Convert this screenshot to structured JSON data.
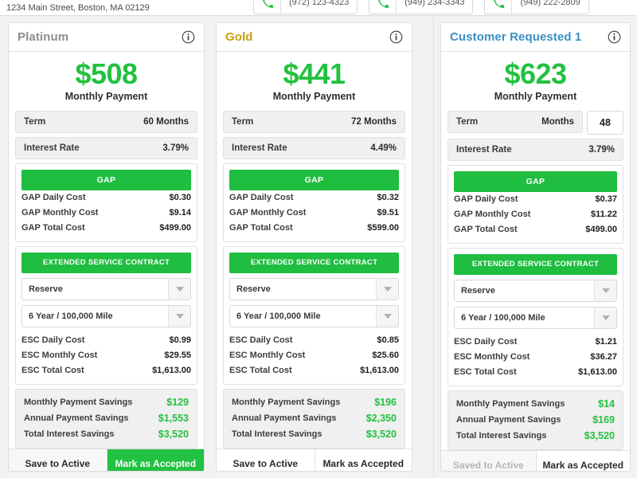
{
  "topbar": {
    "address": "1234 Main Street, Boston, MA 02129",
    "phones": [
      {
        "number": "(972) 123-4323",
        "icon": "phone-icon"
      },
      {
        "number": "(949) 234-3343",
        "icon": "phone-icon"
      },
      {
        "number": "(949) 222-2809",
        "icon": "phone-icon"
      }
    ]
  },
  "colors": {
    "green": "#21c141",
    "gold": "#c7a008",
    "platinum_gray": "#8e8e8e",
    "custom_blue": "#3a8fc0",
    "savings_green": "#22c13f"
  },
  "common": {
    "monthly_payment_label": "Monthly Payment",
    "term_label": "Term",
    "interest_rate_label": "Interest Rate",
    "gap_header": "GAP",
    "gap_daily_label": "GAP Daily Cost",
    "gap_monthly_label": "GAP Monthly Cost",
    "gap_total_label": "GAP Total Cost",
    "esc_header": "EXTENDED SERVICE CONTRACT",
    "esc_daily_label": "ESC Daily Cost",
    "esc_monthly_label": "ESC Monthly Cost",
    "esc_total_label": "ESC Total Cost",
    "monthly_savings_label": "Monthly Payment Savings",
    "annual_savings_label": "Annual Payment Savings",
    "total_interest_savings_label": "Total Interest Savings",
    "info_icon": "info-icon",
    "dropdown_icon": "chevron-down-icon"
  },
  "cards": [
    {
      "title": "Platinum",
      "payment": "$508",
      "term_value": "60 Months",
      "term_editable": false,
      "interest_rate": "3.79%",
      "gap": {
        "daily": "$0.30",
        "monthly": "$9.14",
        "total": "$499.00"
      },
      "esc": {
        "provider": "Reserve",
        "coverage": "6 Year / 100,000 Mile",
        "daily": "$0.99",
        "monthly": "$29.55",
        "total": "$1,613.00"
      },
      "savings": {
        "monthly": "$129",
        "annual": "$1,553",
        "interest": "$3,520"
      },
      "footer": {
        "save_label": "Save to Active",
        "save_state": "enabled",
        "accept_label": "Mark as Accepted",
        "accept_state": "accepted"
      }
    },
    {
      "title": "Gold",
      "payment": "$441",
      "term_value": "72 Months",
      "term_editable": false,
      "interest_rate": "4.49%",
      "gap": {
        "daily": "$0.32",
        "monthly": "$9.51",
        "total": "$599.00"
      },
      "esc": {
        "provider": "Reserve",
        "coverage": "6 Year / 100,000 Mile",
        "daily": "$0.85",
        "monthly": "$25.60",
        "total": "$1,613.00"
      },
      "savings": {
        "monthly": "$196",
        "annual": "$2,350",
        "interest": "$3,520"
      },
      "footer": {
        "save_label": "Save to Active",
        "save_state": "enabled",
        "accept_label": "Mark as Accepted",
        "accept_state": "enabled"
      }
    },
    {
      "title": "Customer Requested 1",
      "payment": "$623",
      "term_value": "Months",
      "term_input_value": "48",
      "term_editable": true,
      "interest_rate": "3.79%",
      "gap": {
        "daily": "$0.37",
        "monthly": "$11.22",
        "total": "$499.00"
      },
      "esc": {
        "provider": "Reserve",
        "coverage": "6 Year / 100,000 Mile",
        "daily": "$1.21",
        "monthly": "$36.27",
        "total": "$1,613.00"
      },
      "savings": {
        "monthly": "$14",
        "annual": "$169",
        "interest": "$3,520"
      },
      "footer": {
        "save_label": "Saved to Active",
        "save_state": "disabled",
        "accept_label": "Mark as Accepted",
        "accept_state": "enabled"
      }
    }
  ]
}
